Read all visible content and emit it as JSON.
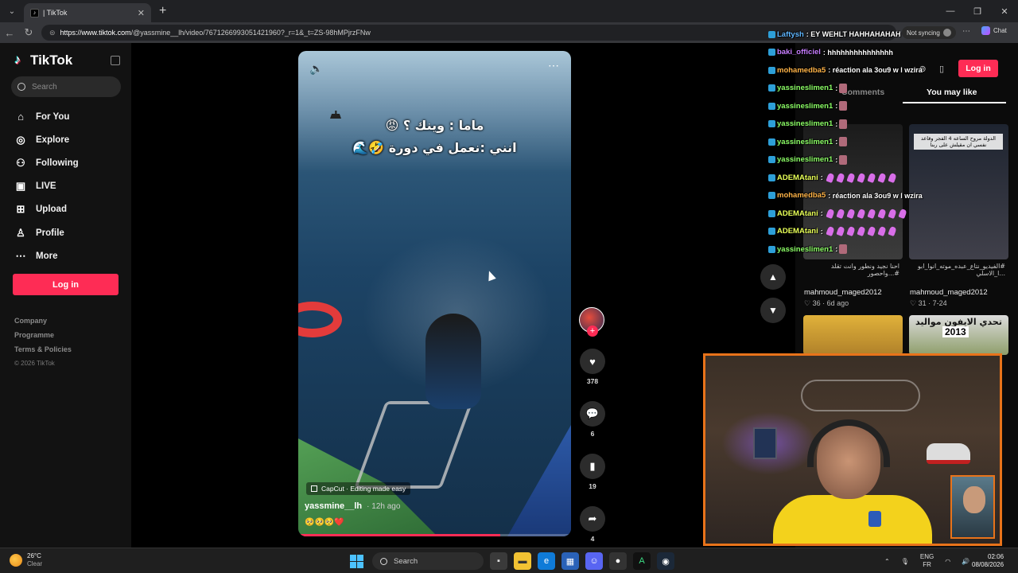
{
  "browser": {
    "tab_title": "| TikTok",
    "tab_close": "✕",
    "new_tab": "+",
    "url_host": "https://www.tiktok.com",
    "url_path": "/@yassmine__lh/video/7671266993051421960?_r=1&_t=ZS-98hMPjrzFNw",
    "sync_label": "Not syncing",
    "chat_label": "Chat"
  },
  "sidebar": {
    "logo_text": "TikTok",
    "search_placeholder": "Search",
    "items": [
      {
        "label": "For You",
        "icon": "home-icon",
        "glyph": "⌂"
      },
      {
        "label": "Explore",
        "icon": "compass-icon",
        "glyph": "◎"
      },
      {
        "label": "Following",
        "icon": "person-plus-icon",
        "glyph": "⚇"
      },
      {
        "label": "LIVE",
        "icon": "live-tv-icon",
        "glyph": "▣"
      },
      {
        "label": "Upload",
        "icon": "upload-plus-icon",
        "glyph": "⊞"
      },
      {
        "label": "Profile",
        "icon": "profile-icon",
        "glyph": "♙"
      },
      {
        "label": "More",
        "icon": "more-dots-icon",
        "glyph": "⋯"
      }
    ],
    "login_label": "Log in",
    "footer": [
      "Company",
      "Programme",
      "Terms & Policies"
    ],
    "copyright": "© 2026 TikTok"
  },
  "video": {
    "caption_line1": "ماما : وينك ؟ 😡",
    "caption_line2": "انني :نعمل في دورة 🤣🌊",
    "capcut_label": "CapCut · Editing made easy",
    "author": "yassmine__lh",
    "posted": "· 12h ago",
    "description": "🥺🥺🥺❤️",
    "progress": 0.74
  },
  "actions": {
    "likes": "378",
    "comments": "6",
    "saves": "19",
    "shares": "4"
  },
  "right_panel": {
    "login_label": "Log in",
    "tab_comments": "Comments",
    "tab_like": "You may like",
    "cards": [
      {
        "title": "احنا نجيد ونطور وانت تقلد #...واحصور",
        "user": "mahmoud_maged2012",
        "stats": "♡ 36 · 6d ago"
      },
      {
        "title": "#الفيديو_نتاع_عبده_موته_انوا_ابو ...ا_الاسلي",
        "user": "mahmoud_maged2012",
        "stats": "♡ 31 · 7-24"
      }
    ],
    "thumb2_label": "الدولة مروح الساعه 4 الفجر وقاعد نفسي ان مقيلش على ربنا",
    "thumb4_text": "تحدي الايفون مواليد",
    "thumb4_year": "2013"
  },
  "chat": [
    {
      "name": "Laftysh",
      "color": "#5fb6ff",
      "msg": ": EY WEHLT HAHHAHAHAH",
      "emotes": 0,
      "purple": 0
    },
    {
      "name": "baki_officiel",
      "color": "#c77dff",
      "msg": ": hhhhhhhhhhhhhhh",
      "emotes": 0,
      "purple": 0
    },
    {
      "name": "mohamedba5",
      "color": "#ffb347",
      "msg": ": réaction ala 3ou9 w l wzira",
      "emotes": 0,
      "purple": 0
    },
    {
      "name": "yassineslimen1",
      "color": "#8cff66",
      "msg": ":",
      "emotes": 1,
      "purple": 0
    },
    {
      "name": "yassineslimen1",
      "color": "#8cff66",
      "msg": ":",
      "emotes": 1,
      "purple": 0
    },
    {
      "name": "yassineslimen1",
      "color": "#8cff66",
      "msg": ":",
      "emotes": 1,
      "purple": 0
    },
    {
      "name": "yassineslimen1",
      "color": "#8cff66",
      "msg": ":",
      "emotes": 1,
      "purple": 0
    },
    {
      "name": "yassineslimen1",
      "color": "#8cff66",
      "msg": ":",
      "emotes": 1,
      "purple": 0
    },
    {
      "name": "ADEMAtani",
      "color": "#e8ff57",
      "msg": ":",
      "emotes": 0,
      "purple": 7
    },
    {
      "name": "mohamedba5",
      "color": "#ffb347",
      "msg": ": réaction ala 3ou9 w l wzira",
      "emotes": 0,
      "purple": 0
    },
    {
      "name": "ADEMAtani",
      "color": "#e8ff57",
      "msg": ":",
      "emotes": 0,
      "purple": 8
    },
    {
      "name": "ADEMAtani",
      "color": "#e8ff57",
      "msg": ":",
      "emotes": 0,
      "purple": 7
    },
    {
      "name": "yassineslimen1",
      "color": "#8cff66",
      "msg": ":",
      "emotes": 1,
      "purple": 0
    }
  ],
  "taskbar": {
    "temp": "26°C",
    "weather": "Clear",
    "search": "Search",
    "lang1": "ENG",
    "lang2": "FR",
    "time": "02:06",
    "date": "08/08/2026"
  },
  "colors": {
    "brand_pink": "#fe2c55",
    "cam_frame": "#e8731a"
  }
}
